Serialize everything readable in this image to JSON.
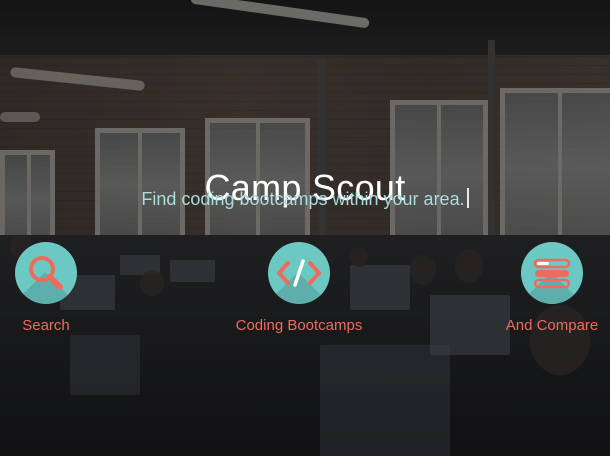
{
  "hero": {
    "title": "Camp Scout",
    "tagline": "Find coding bootcamps within your area."
  },
  "features": [
    {
      "icon": "magnifier-icon",
      "label": "Search"
    },
    {
      "icon": "code-brackets-icon",
      "label": "Coding Bootcamps"
    },
    {
      "icon": "stacked-list-icon",
      "label": "And Compare"
    }
  ],
  "colors": {
    "accent": "#f06a5b",
    "badge": "#6cc8c3",
    "tagline": "#a9dcdb",
    "title": "#ffffff"
  }
}
